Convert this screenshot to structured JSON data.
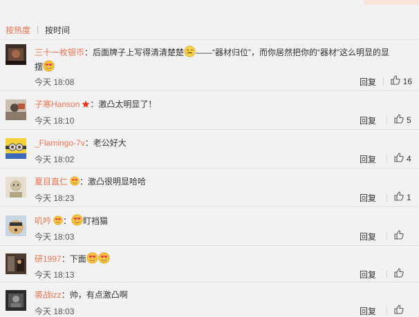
{
  "sort_tabs": {
    "hot": "按热度",
    "time": "按时间"
  },
  "reply_label": "回复",
  "colors": {
    "accent": "#eb7350",
    "text": "#333333",
    "meta": "#555555",
    "background": "#f2f2f2"
  },
  "comments": [
    {
      "username": "三十一枚银币",
      "text": "后面牌子上写得清清楚楚",
      "text_b": "——“器材归位”，而你居然把你的“器材”这么明显的显",
      "text_c": "摆",
      "emojis": [
        "squint-face-emoji",
        "heart-eyes-emoji"
      ],
      "time": "今天 18:08",
      "likes": "16"
    },
    {
      "username": "子寒Hanson",
      "text": "激凸太明显了！",
      "badges": [
        "star-badge-icon"
      ],
      "time": "今天 18:10",
      "likes": "5"
    },
    {
      "username": "_Flamingo-7v",
      "text": "老公好大",
      "time": "今天 18:02",
      "likes": "4"
    },
    {
      "username": "夏目直仁",
      "text": "激凸很明显哈哈",
      "badges": [
        "heart-eyes-badge-icon"
      ],
      "time": "今天 18:23",
      "likes": "1"
    },
    {
      "username": "叽吟",
      "text": "盯裆猫",
      "badges": [
        "heart-eyes-badge-icon"
      ],
      "emojis": [
        "heart-eyes-emoji"
      ],
      "time": "今天 18:03",
      "likes": ""
    },
    {
      "username": "研1997",
      "text": "下面",
      "emojis": [
        "heart-eyes-emoji",
        "heart-eyes-emoji"
      ],
      "time": "今天 18:13",
      "likes": ""
    },
    {
      "username": "裘战izz",
      "text": "帅，有点激凸啊",
      "time": "今天 18:03",
      "likes": ""
    }
  ]
}
